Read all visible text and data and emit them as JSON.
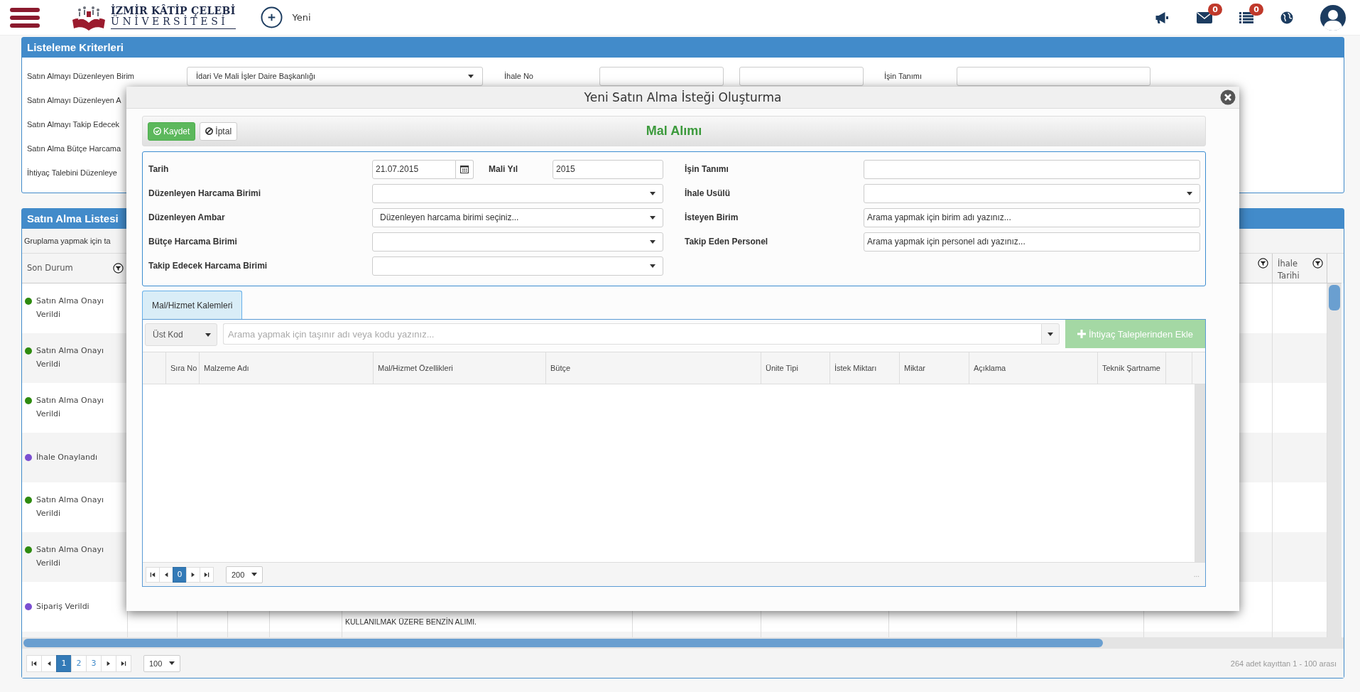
{
  "topbar": {
    "logo_title": "İZMİR KÂTİP ÇELEBİ",
    "logo_subtitle": "ÜNİVERSİTESİ",
    "new_label": "Yeni",
    "icons": [
      {
        "kind": "megaphone"
      },
      {
        "kind": "mail",
        "count": "0"
      },
      {
        "kind": "list",
        "count": "0"
      },
      {
        "kind": "globe"
      },
      {
        "kind": "avatar"
      }
    ]
  },
  "criteria": {
    "title": "Listeleme Kriterleri",
    "unit_label": "Satın Almayı Düzenleyen Birim",
    "unit_value": "İdari Ve Mali İşler Daire Başkanlığı",
    "tender_no_label": "İhale No",
    "job_label": "İşin Tanımı",
    "more_labels": [
      "Satın Almayı Düzenleyen A",
      "Satın Almayı Takip Edecek",
      "Satın Alma Bütçe Harcama",
      "İhtiyaç Talebini Düzenleye"
    ]
  },
  "list": {
    "title": "Satın Alma Listesi",
    "group_hint": "Gruplama yapmak için ta",
    "columns": [
      {
        "label": "Son Durum",
        "filter": true
      },
      {
        "filter": true
      },
      {
        "label": "İhale Tarihi",
        "filter": true
      }
    ],
    "rows": [
      {
        "status": "Satın Alma Onayı Verildi",
        "color": "#2e8b0f"
      },
      {
        "status": "Satın Alma Onayı Verildi",
        "color": "#2e8b0f"
      },
      {
        "status": "Satın Alma Onayı Verildi",
        "color": "#2e8b0f"
      },
      {
        "status": "İhale Onaylandı",
        "color": "#7b4fd1"
      },
      {
        "status": "Satın Alma Onayı Verildi",
        "color": "#2e8b0f"
      },
      {
        "status": "Satın Alma Onayı Verildi",
        "color": "#2e8b0f"
      },
      {
        "status": "Sipariş Verildi",
        "color": "#7b4fd1",
        "description": "KULLANILMAK ÜZERE BENZİN ALIMI."
      }
    ],
    "pages": [
      {
        "label": "1",
        "selected": true
      },
      {
        "label": "2",
        "selected": false
      },
      {
        "label": "3",
        "selected": false
      }
    ],
    "page_size": "100",
    "summary": "264 adet kayıttan 1 - 100 arası"
  },
  "modal": {
    "title": "Yeni Satın Alma İsteği Oluşturma",
    "buttons": [
      {
        "label": "Kaydet",
        "kind": "save"
      },
      {
        "label": "İptal",
        "kind": "cancel"
      }
    ],
    "heading": "Mal Alımı",
    "date": {
      "label": "Tarih",
      "value": "21.07.2015"
    },
    "year": {
      "label": "Mali Yıl",
      "value": "2015"
    },
    "left_fields": [
      {
        "label": "Düzenleyen Harcama Birimi",
        "kind": "select"
      },
      {
        "label": "Düzenleyen Ambar",
        "kind": "select",
        "value": "Düzenleyen harcama birimi seçiniz..."
      },
      {
        "label": "Bütçe Harcama Birimi",
        "kind": "select"
      },
      {
        "label": "Takip Edecek Harcama Birimi",
        "kind": "select"
      }
    ],
    "right_fields": [
      {
        "label": "İşin Tanımı",
        "kind": "text"
      },
      {
        "label": "İhale Usülü",
        "kind": "select"
      },
      {
        "label": "İsteyen Birim",
        "kind": "text",
        "value": "Arama yapmak için birim adı yazınız..."
      },
      {
        "label": "Takip Eden Personel",
        "kind": "text",
        "value": "Arama yapmak için personel adı yazınız..."
      }
    ],
    "tabs": [
      {
        "label": "Mal/Hizmet Kalemleri",
        "selected": true
      }
    ],
    "grid": {
      "code_select": "Üst Kod",
      "search": {
        "placeholder": "Arama yapmak için taşınır adı veya kodu yazınız..."
      },
      "add_button": {
        "label": "İhtiyaç Taleplerinden Ekle",
        "disabled": true
      },
      "columns": [
        "Sıra No",
        "Malzeme Adı",
        "Mal/Hizmet Özellikleri",
        "Bütçe",
        "Ünite Tipi",
        "İstek Miktarı",
        "Miktar",
        "Açıklama",
        "Teknik Şartname"
      ],
      "pages": [
        {
          "label": "0",
          "selected": true
        }
      ],
      "page_size": "200",
      "more": "..."
    }
  }
}
